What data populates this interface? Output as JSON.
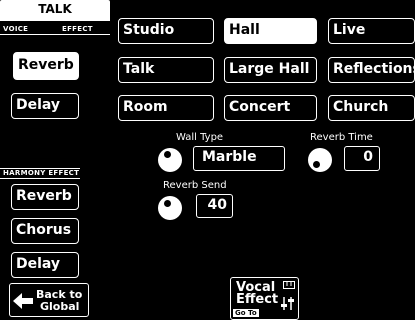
{
  "sidebar": {
    "tab_label": "TALK",
    "voice_label": "VOICE",
    "effect_label": "EFFECT",
    "voice_buttons": [
      "Reverb",
      "Delay"
    ],
    "harmony_label": "HARMONY EFFECT",
    "harmony_buttons": [
      "Reverb",
      "Chorus",
      "Delay"
    ],
    "back_line1": "Back to",
    "back_line2": "Global"
  },
  "presets": [
    "Studio",
    "Hall",
    "Live",
    "Talk",
    "Large Hall",
    "Reflections",
    "Room",
    "Concert",
    "Church"
  ],
  "selected_preset": "Hall",
  "params": {
    "wall_type_label": "Wall Type",
    "wall_type_value": "Marble",
    "reverb_time_label": "Reverb Time",
    "reverb_time_value": "0",
    "reverb_send_label": "Reverb Send",
    "reverb_send_value": "40"
  },
  "vocal_effect": {
    "line1": "Vocal",
    "line2": "Effect",
    "goto": "Go To"
  },
  "icons": [
    "left-arrow-icon",
    "keyboard-icon",
    "sliders-icon",
    "knob-icon"
  ]
}
